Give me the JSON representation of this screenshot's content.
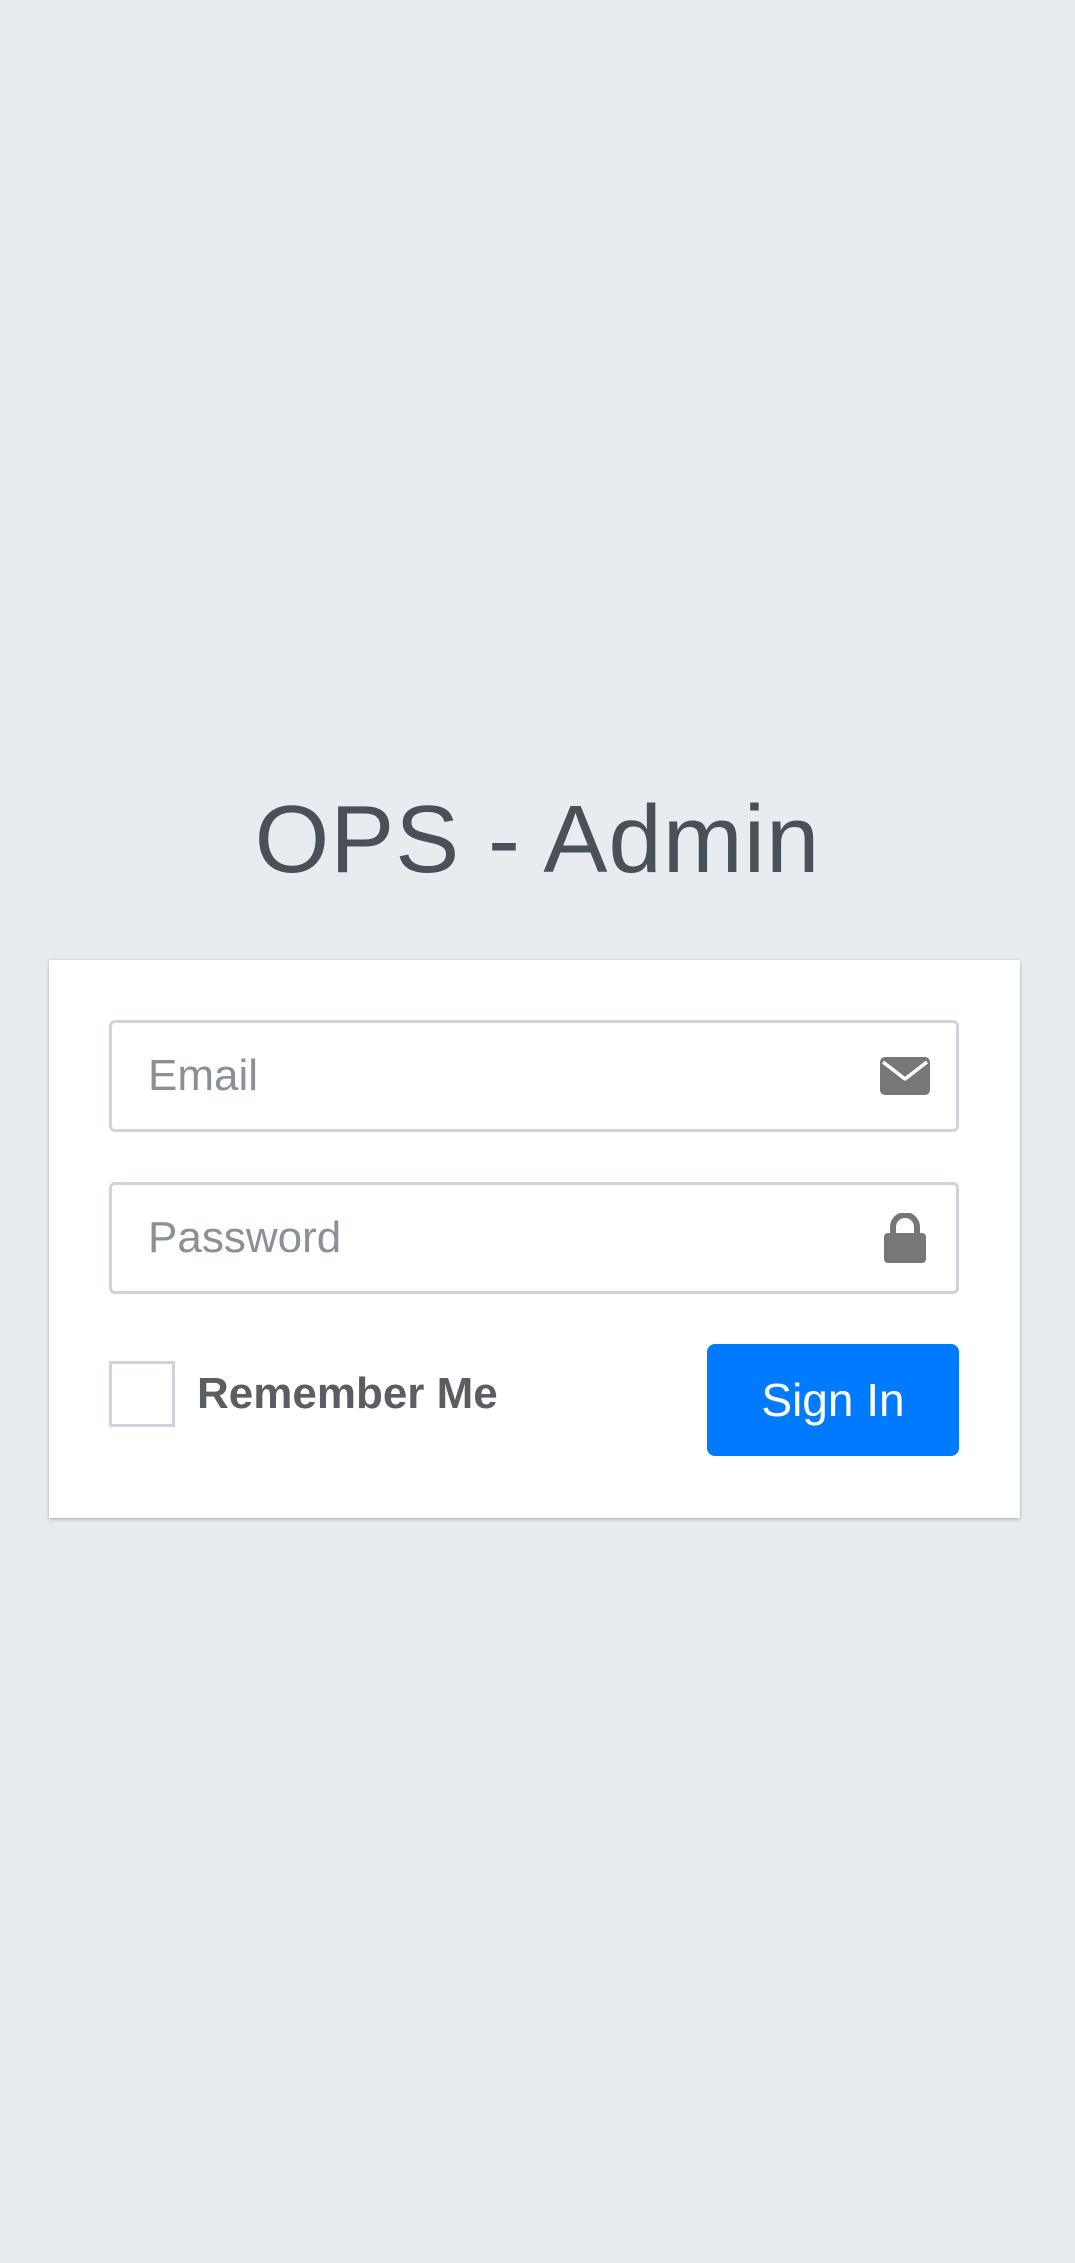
{
  "login": {
    "title": "OPS - Admin",
    "email_placeholder": "Email",
    "password_placeholder": "Password",
    "remember_label": "Remember Me",
    "remember_checked": false,
    "signin_label": "Sign In"
  },
  "icons": {
    "email": "envelope-icon",
    "password": "lock-icon"
  },
  "colors": {
    "background": "#e9ecef",
    "primary": "#007bff",
    "title": "#495057",
    "icon": "#777777",
    "border": "#ced4da"
  }
}
